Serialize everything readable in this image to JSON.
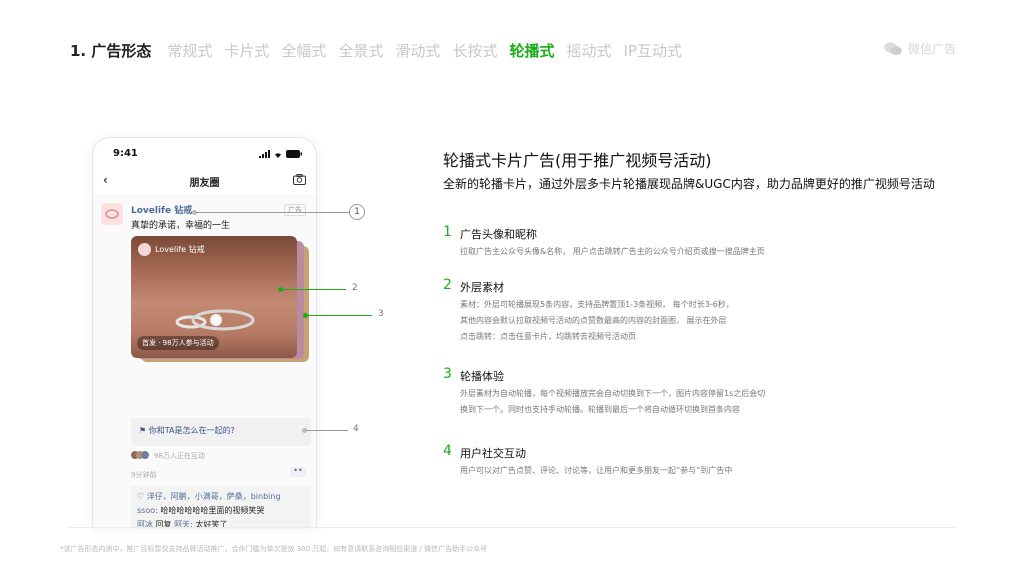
{
  "nav": {
    "title": "1. 广告形态",
    "tabs": [
      "常规式",
      "卡片式",
      "全幅式",
      "全景式",
      "滑动式",
      "长按式",
      "轮播式",
      "摇动式",
      "IP互动式"
    ],
    "active_tab": "轮播式",
    "brand": "微信广告",
    "accent_color": "#1aad19"
  },
  "phone": {
    "time": "9:41",
    "header_title": "朋友圈",
    "icons": [
      "signal-icon",
      "wifi-icon",
      "battery-icon",
      "back-icon",
      "camera-icon"
    ],
    "post": {
      "brand_name": "Lovelife 钻戒",
      "ad_tag": "广告",
      "slogan": "真挚的承诺，幸福的一生",
      "card_brand": "Lovelife 钻戒",
      "card_badge": "首发 · 98万人参与活动",
      "question": "你和TA是怎么在一起的?",
      "participants": "98万人正在互动",
      "timestamp": "9分钟前",
      "more": "••",
      "likes": "洋仔，阿鹏，小满哥，萨桑，binbing",
      "comment1_user": "ssoo:",
      "comment1_text": " 哈哈哈哈哈哈里面的视频笑哭",
      "comment2_user": "阿冰",
      "comment2_reply": " 回复 ",
      "comment2_target": "阿天:",
      "comment2_text": " 太好笑了"
    }
  },
  "callouts": [
    "1",
    "2",
    "3",
    "4"
  ],
  "content": {
    "title": "轮播式卡片广告(用于推广视频号活动)",
    "subtitle": "全新的轮播卡片，通过外层多卡片轮播展现品牌&UGC内容，助力品牌更好的推广视频号活动",
    "features": [
      {
        "num": "1",
        "title": "广告头像和昵称",
        "desc": [
          "拉取广告主公众号头像&名称，  用户点击跳转广告主的公众号介绍页或搜一搜品牌主页"
        ]
      },
      {
        "num": "2",
        "title": "外层素材",
        "desc": [
          "素材：外层可轮播展现5条内容，支持品牌置顶1-3条视频，  每个时长3-6秒，",
          "其他内容会默认拉取视频号活动的点赞数最高的内容的封面图，  展示在外层",
          "点击跳转：点击任意卡片，均跳转去视频号活动页"
        ]
      },
      {
        "num": "3",
        "title": "轮播体验",
        "desc": [
          "外层素材为自动轮播，每个视频播放完会自动切换到下一个，图片内容停留1s之后会切",
          "换到下一个。同时也支持手动轮播。轮播到最后一个将自动循环切换到首条内容"
        ]
      },
      {
        "num": "4",
        "title": "用户社交互动",
        "desc": [
          "用户可以对广告点赞、评论、讨论等，让用户和更多朋友一起“参与”到广告中"
        ]
      }
    ]
  },
  "footnote": "*该广告形态内测中，推广目标暂仅支持品牌活动推广，合作门槛为单次投放 300 万起，如有意请联系咨询相应渠道 / 微信广告助手公众号"
}
